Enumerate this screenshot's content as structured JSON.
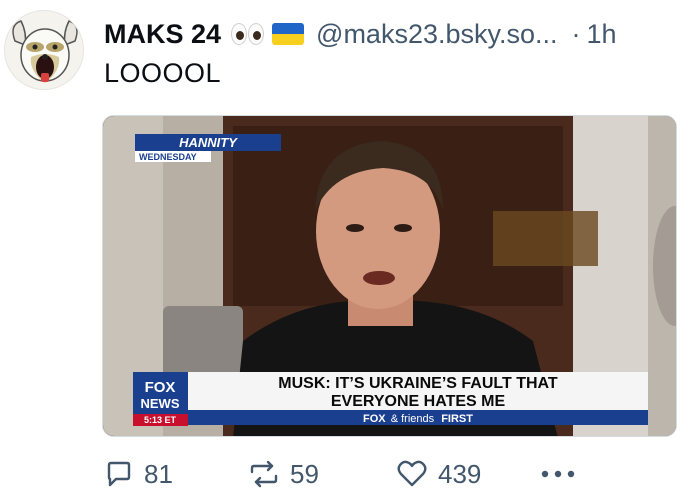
{
  "author": {
    "display_name": "MAKS 24",
    "handle": "@maks23.bsky.so...",
    "separator": "·",
    "time_ago": "1h",
    "avatar_icon": "dog-face-icon",
    "name_emojis": [
      "eyes-emoji",
      "ukraine-flag-emoji"
    ]
  },
  "post": {
    "text": "LOOOOL"
  },
  "media": {
    "show_name": "HANNITY",
    "day": "WEDNESDAY",
    "network_logo_top": "FOX",
    "network_logo_bottom": "NEWS",
    "time_stamp": "5:13 ET",
    "headline_line1": "MUSK: IT’S UKRAINE’S FAULT THAT",
    "headline_line2": "EVERYONE HATES ME",
    "footer_fox": "FOX",
    "footer_friends": "& friends",
    "footer_first": "FIRST"
  },
  "actions": {
    "reply_count": "81",
    "repost_count": "59",
    "like_count": "439"
  },
  "colors": {
    "secondary_text": "#42576c",
    "fox_blue": "#1b3f8f",
    "ukraine_blue": "#1f66c8",
    "ukraine_yellow": "#f6cf1f"
  }
}
